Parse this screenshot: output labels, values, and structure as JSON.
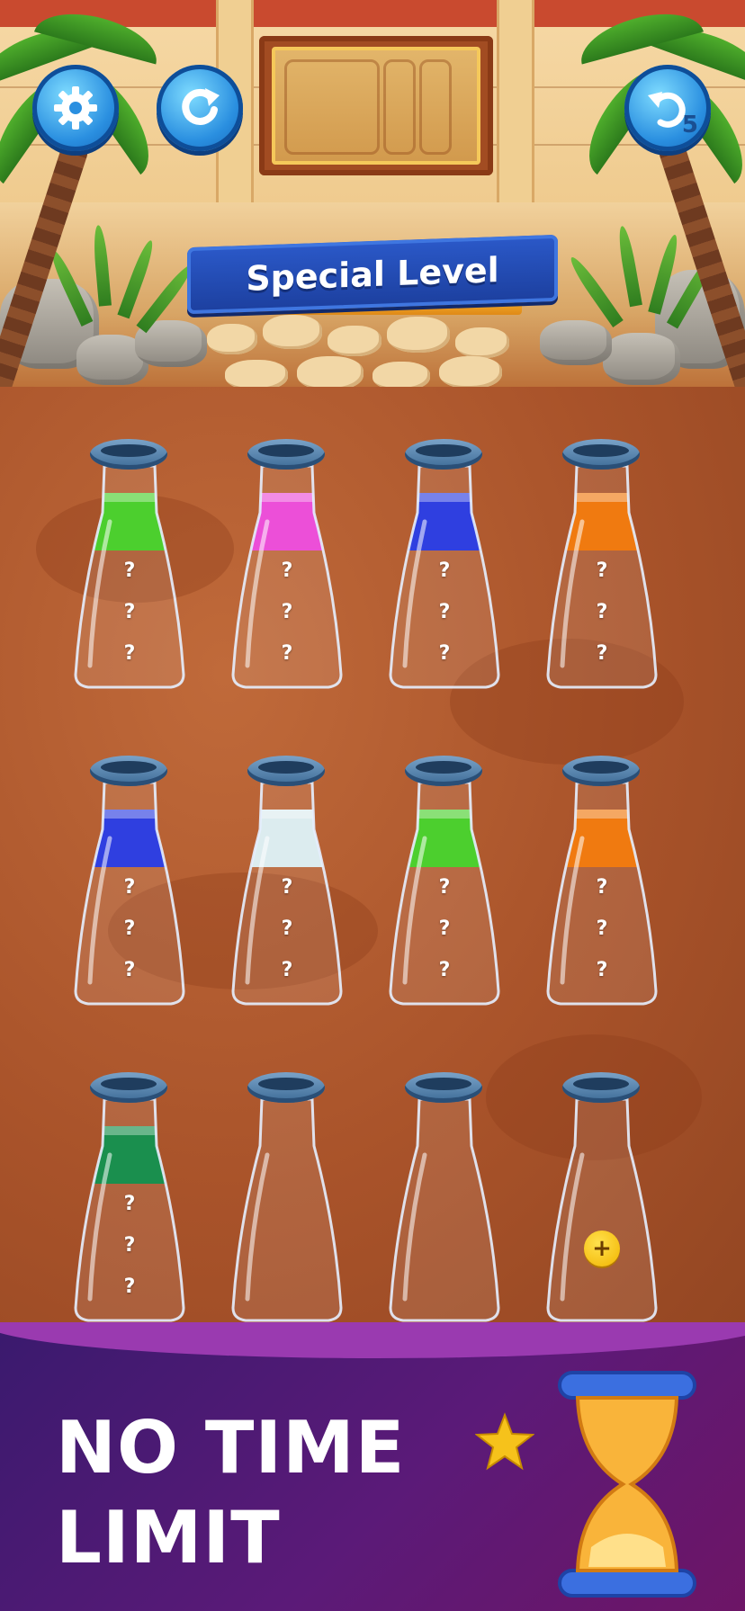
{
  "header": {
    "settings_icon": "gear-icon",
    "restart_icon": "restart-icon",
    "undo_icon": "undo-icon",
    "undo_count": "5"
  },
  "banner": {
    "title": "Special Level"
  },
  "colors": {
    "green": "#4ccf2e",
    "pink": "#ec4fd8",
    "blue": "#2f3fe0",
    "orange": "#f07a10",
    "white": "#dcecef",
    "darkgreen": "#1a8f4e",
    "accent_blue": "#2b59c9"
  },
  "bottles": [
    {
      "row": 1,
      "top_color": "green",
      "hidden": [
        "?",
        "?",
        "?"
      ]
    },
    {
      "row": 1,
      "top_color": "pink",
      "hidden": [
        "?",
        "?",
        "?"
      ]
    },
    {
      "row": 1,
      "top_color": "blue",
      "hidden": [
        "?",
        "?",
        "?"
      ]
    },
    {
      "row": 1,
      "top_color": "orange",
      "hidden": [
        "?",
        "?",
        "?"
      ]
    },
    {
      "row": 2,
      "top_color": "blue",
      "hidden": [
        "?",
        "?",
        "?"
      ]
    },
    {
      "row": 2,
      "top_color": "white",
      "hidden": [
        "?",
        "?",
        "?"
      ]
    },
    {
      "row": 2,
      "top_color": "green",
      "hidden": [
        "?",
        "?",
        "?"
      ]
    },
    {
      "row": 2,
      "top_color": "orange",
      "hidden": [
        "?",
        "?",
        "?"
      ]
    },
    {
      "row": 3,
      "top_color": "darkgreen",
      "hidden": [
        "?",
        "?",
        "?"
      ]
    },
    {
      "row": 3,
      "top_color": null,
      "hidden": []
    },
    {
      "row": 3,
      "top_color": null,
      "hidden": []
    },
    {
      "row": 3,
      "top_color": null,
      "hidden": [],
      "add_badge": "+"
    }
  ],
  "promo": {
    "line1": "NO TIME",
    "line2": "LIMIT"
  }
}
